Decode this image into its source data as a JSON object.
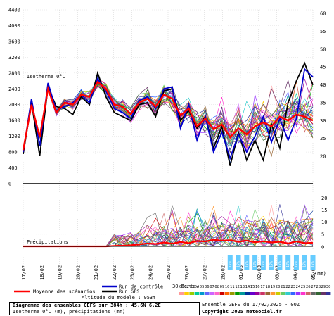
{
  "chart_data": {
    "type": "line",
    "title": "Diagramme des ensembles GEFS sur 384h : 45.6N 6.2E",
    "subtitle": "Isotherme 0°C (m), précipitations (mm)",
    "run_info": "Ensemble GEFS du 17/02/2025 - 00Z",
    "copyright": "Copyright 2025 Meteociel.fr",
    "model_altitude": "Altitude du modele : 953m",
    "upper_panel_label": "Isotherme 0°C",
    "lower_panel_label": "Précipitations",
    "unit_label": "(mm)",
    "y_left": {
      "range": [
        0,
        4400
      ],
      "ticks": [
        4400,
        4000,
        3600,
        3200,
        2800,
        2400,
        2000,
        1600,
        1200,
        800,
        400,
        0
      ]
    },
    "y_right_upper": {
      "range": [
        0,
        60
      ],
      "ticks": [
        60,
        55,
        50,
        45,
        40,
        35,
        30,
        25,
        20
      ]
    },
    "y_right_lower": {
      "range": [
        0,
        20
      ],
      "ticks": [
        20,
        15,
        10,
        5,
        0
      ]
    },
    "x_dates": [
      "17/02",
      "18/02",
      "19/02",
      "20/02",
      "21/02",
      "22/02",
      "23/02",
      "24/02",
      "25/02",
      "26/02",
      "27/02",
      "28/02",
      "01/03",
      "02/03",
      "03/03",
      "04/03",
      "05/03"
    ],
    "members_label": "30 Perts.",
    "member_numbers": [
      "01",
      "02",
      "03",
      "04",
      "05",
      "06",
      "07",
      "08",
      "09",
      "10",
      "11",
      "12",
      "13",
      "14",
      "15",
      "16",
      "17",
      "18",
      "19",
      "20",
      "21",
      "22",
      "23",
      "24",
      "25",
      "26",
      "27",
      "28",
      "29",
      "30"
    ],
    "member_colors": [
      "#ff9999",
      "#ffcc00",
      "#99cc00",
      "#00cc99",
      "#0099cc",
      "#6666ff",
      "#cc66ff",
      "#ff66cc",
      "#cc0000",
      "#ff6600",
      "#999900",
      "#009900",
      "#009999",
      "#003399",
      "#6600cc",
      "#990099",
      "#cc3366",
      "#996633",
      "#ff9933",
      "#cccc00",
      "#66cc66",
      "#33cccc",
      "#3366ff",
      "#9933ff",
      "#ff33cc",
      "#cc6666",
      "#666666",
      "#336633",
      "#663366",
      "#333399"
    ],
    "legend": [
      {
        "label": "Moyenne des scénarios",
        "color": "#ff0000"
      },
      {
        "label": "Run de contrôle",
        "color": "#0000cc"
      },
      {
        "label": "Run GFS",
        "color": "#000000"
      }
    ],
    "precip_probability_label": "17%",
    "series": {
      "mean": [
        850,
        2000,
        1180,
        2400,
        1800,
        2050,
        2000,
        2250,
        2200,
        2580,
        2400,
        2000,
        1950,
        1760,
        2050,
        2150,
        1950,
        2250,
        2150,
        1730,
        1900,
        1450,
        1650,
        1380,
        1500,
        1180,
        1400,
        1250,
        1450,
        1550,
        1450,
        1700,
        1600,
        1750,
        1700,
        1600
      ],
      "control": [
        800,
        2150,
        950,
        2550,
        1850,
        1950,
        2050,
        2250,
        2050,
        2650,
        2350,
        1900,
        1800,
        1650,
        2100,
        2200,
        1900,
        2400,
        2450,
        1400,
        2000,
        1100,
        1700,
        800,
        1300,
        650,
        1250,
        800,
        1200,
        1700,
        1050,
        1650,
        1100,
        1650,
        2900,
        2700
      ],
      "gfs": [
        750,
        2050,
        700,
        2450,
        1950,
        1900,
        1750,
        2200,
        2000,
        2800,
        2200,
        1800,
        1700,
        1600,
        2000,
        2050,
        1700,
        2350,
        2400,
        1600,
        1850,
        1400,
        1700,
        900,
        1450,
        450,
        1300,
        600,
        1100,
        600,
        1500,
        900,
        2050,
        2600,
        3050,
        2500
      ],
      "precip_mean": [
        0,
        0,
        0,
        0,
        0,
        0,
        0,
        0,
        0,
        0,
        0,
        0.2,
        0.3,
        0.5,
        0.8,
        1.2,
        1.0,
        1.6,
        1.1,
        1.8,
        1.3,
        2.2,
        2.0,
        2.7,
        2.4,
        2.5,
        1.9,
        2.4,
        1.7,
        2.1,
        1.6,
        1.9,
        1.2,
        2.0,
        1.3,
        1.5
      ]
    }
  }
}
